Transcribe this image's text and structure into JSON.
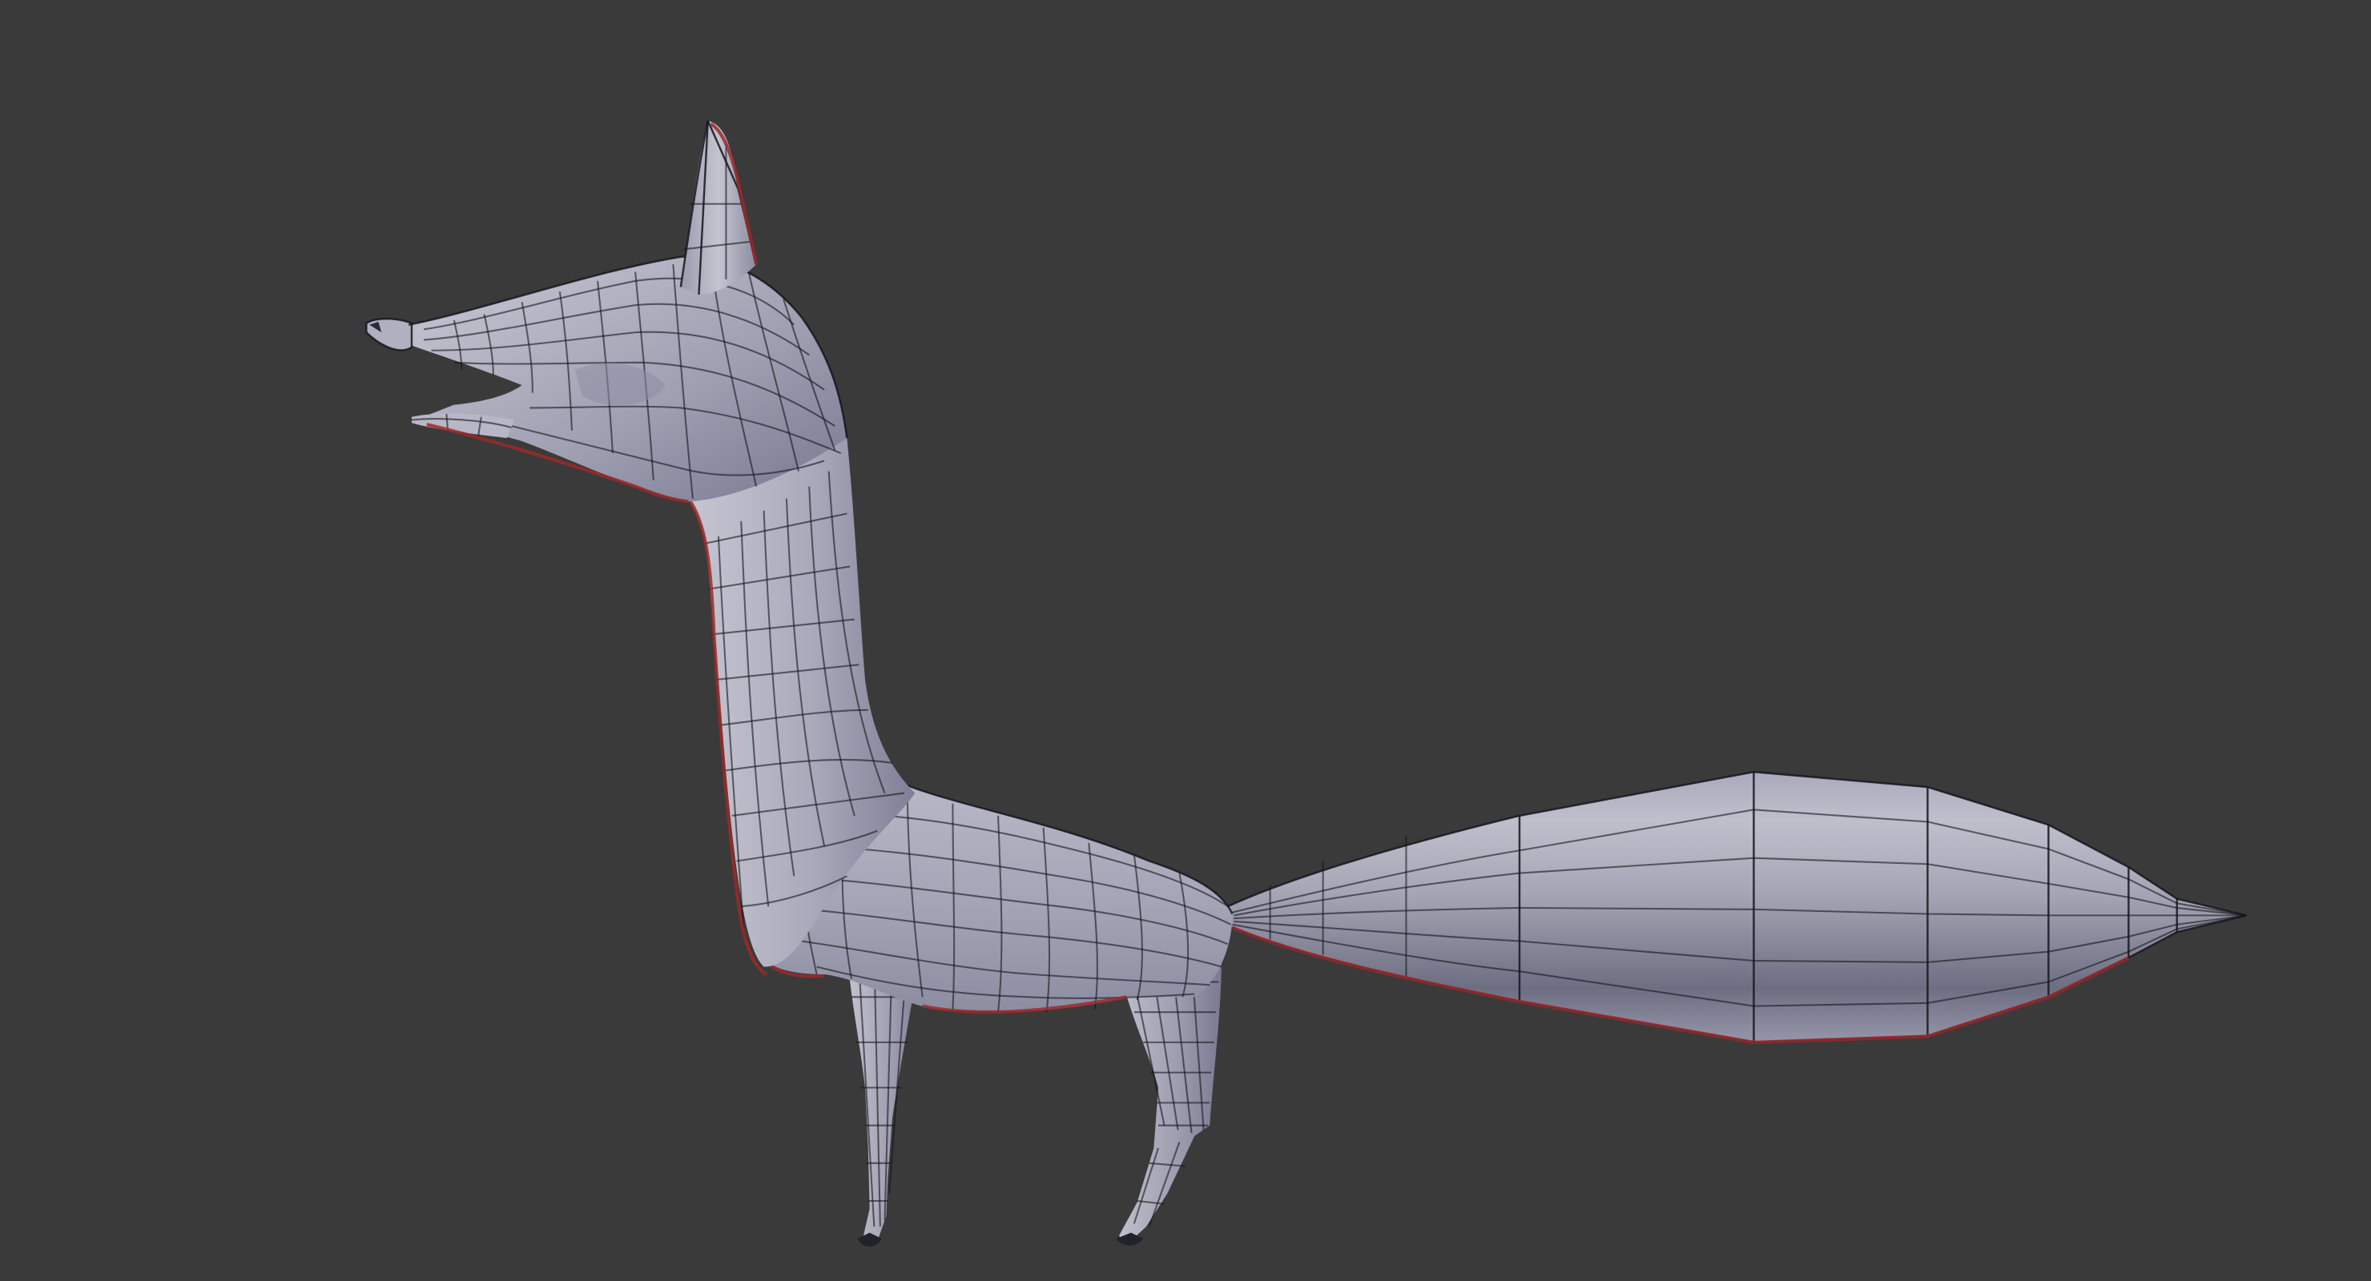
{
  "app": "3D viewport",
  "scene": {
    "object_name": "fox-mesh",
    "shading": "solid",
    "wireframe_overlay": true,
    "background_color": "#3a3a3a",
    "mesh_color": "#a8a8ba",
    "wire_color": "#15151d",
    "seam_color": "#9a2a2a"
  }
}
